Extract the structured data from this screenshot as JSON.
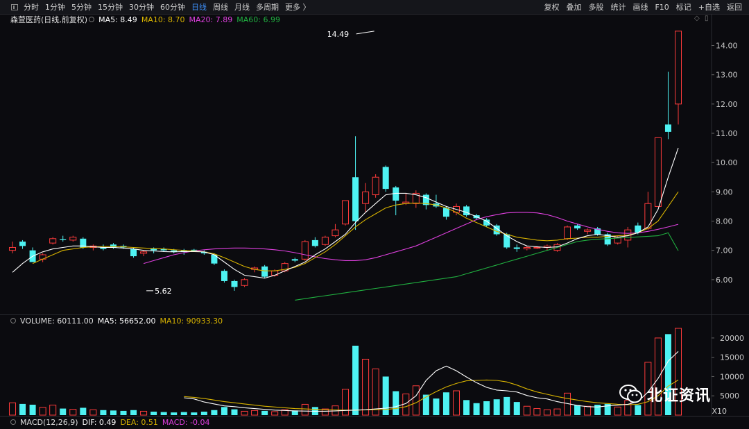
{
  "toolbar": {
    "timeframes": [
      "分时",
      "1分钟",
      "5分钟",
      "15分钟",
      "30分钟",
      "60分钟",
      "日线",
      "周线",
      "月线",
      "多周期",
      "更多 〉"
    ],
    "active_timeframe": "日线",
    "right_items": [
      "复权",
      "叠加",
      "多股",
      "统计",
      "画线",
      "F10",
      "标记",
      "+自选",
      "返回"
    ]
  },
  "main_indicator": {
    "title": "森萱医药(日线,前复权)",
    "ma5": "MA5: 8.49",
    "ma10": "MA10: 8.70",
    "ma20": "MA20: 7.89",
    "ma60": "MA60: 6.99"
  },
  "volume_indicator": {
    "vol": "VOLUME: 60111.00",
    "ma5": "MA5: 56652.00",
    "ma10": "MA10: 90933.30"
  },
  "macd_indicator": {
    "name": "MACD(12,26,9)",
    "dif": "DIF: 0.49",
    "dea": "DEA: 0.51",
    "macd": "MACD: -0.04"
  },
  "scale_label": "X10",
  "watermark": "北证资讯",
  "colors": {
    "up": "#ff3b3b",
    "down": "#4ef2f2",
    "ma5": "#ffffff",
    "ma10": "#d8b300",
    "ma20": "#e040e0",
    "ma60": "#20b040",
    "background": "#0b0b0f"
  },
  "chart_data": {
    "type": "candlestick",
    "y_ticks": [
      6.0,
      7.0,
      8.0,
      9.0,
      10.0,
      11.0,
      12.0,
      13.0,
      14.0
    ],
    "ylim": [
      5.0,
      14.7
    ],
    "volume_ticks": [
      5000,
      10000,
      15000,
      20000
    ],
    "volume_ylim": [
      0,
      22500
    ],
    "annotations": [
      {
        "text": "5.62",
        "index": 13,
        "value": 5.62
      },
      {
        "text": "14.49",
        "index": 36,
        "value": 14.49
      }
    ],
    "candles": [
      {
        "o": 7.0,
        "h": 7.3,
        "l": 6.9,
        "c": 7.1,
        "v": 3200
      },
      {
        "o": 7.3,
        "h": 7.35,
        "l": 7.05,
        "c": 7.15,
        "v": 2900
      },
      {
        "o": 7.0,
        "h": 7.1,
        "l": 6.6,
        "c": 6.6,
        "v": 2700
      },
      {
        "o": 6.7,
        "h": 6.9,
        "l": 6.6,
        "c": 6.85,
        "v": 2000
      },
      {
        "o": 7.25,
        "h": 7.45,
        "l": 7.2,
        "c": 7.4,
        "v": 2600
      },
      {
        "o": 7.38,
        "h": 7.5,
        "l": 7.3,
        "c": 7.35,
        "v": 1700
      },
      {
        "o": 7.35,
        "h": 7.5,
        "l": 7.3,
        "c": 7.45,
        "v": 1500
      },
      {
        "o": 7.4,
        "h": 7.45,
        "l": 7.05,
        "c": 7.1,
        "v": 1900
      },
      {
        "o": 7.1,
        "h": 7.2,
        "l": 7.0,
        "c": 7.15,
        "v": 1400
      },
      {
        "o": 7.1,
        "h": 7.2,
        "l": 7.0,
        "c": 7.05,
        "v": 1300
      },
      {
        "o": 7.2,
        "h": 7.25,
        "l": 7.05,
        "c": 7.1,
        "v": 1200
      },
      {
        "o": 7.15,
        "h": 7.2,
        "l": 7.05,
        "c": 7.1,
        "v": 1100
      },
      {
        "o": 7.05,
        "h": 7.1,
        "l": 6.75,
        "c": 6.8,
        "v": 1300
      },
      {
        "o": 6.9,
        "h": 7.0,
        "l": 6.8,
        "c": 6.95,
        "v": 1000
      },
      {
        "o": 7.05,
        "h": 7.1,
        "l": 6.9,
        "c": 7.0,
        "v": 900
      },
      {
        "o": 7.05,
        "h": 7.1,
        "l": 6.95,
        "c": 7.0,
        "v": 800
      },
      {
        "o": 7.0,
        "h": 7.05,
        "l": 6.9,
        "c": 6.95,
        "v": 700
      },
      {
        "o": 7.0,
        "h": 7.05,
        "l": 6.85,
        "c": 6.95,
        "v": 800
      },
      {
        "o": 7.02,
        "h": 7.05,
        "l": 6.95,
        "c": 6.98,
        "v": 700
      },
      {
        "o": 6.95,
        "h": 7.0,
        "l": 6.85,
        "c": 6.9,
        "v": 900
      },
      {
        "o": 6.85,
        "h": 6.9,
        "l": 6.5,
        "c": 6.55,
        "v": 1300
      },
      {
        "o": 6.3,
        "h": 6.35,
        "l": 5.9,
        "c": 5.95,
        "v": 2100
      },
      {
        "o": 5.95,
        "h": 6.0,
        "l": 5.62,
        "c": 5.75,
        "v": 1500
      },
      {
        "o": 5.8,
        "h": 6.05,
        "l": 5.75,
        "c": 6.0,
        "v": 1000
      },
      {
        "o": 6.35,
        "h": 6.45,
        "l": 6.25,
        "c": 6.4,
        "v": 1200
      },
      {
        "o": 6.45,
        "h": 6.5,
        "l": 6.05,
        "c": 6.1,
        "v": 1100
      },
      {
        "o": 6.15,
        "h": 6.35,
        "l": 6.1,
        "c": 6.3,
        "v": 900
      },
      {
        "o": 6.3,
        "h": 6.6,
        "l": 6.25,
        "c": 6.55,
        "v": 1400
      },
      {
        "o": 6.7,
        "h": 6.75,
        "l": 6.6,
        "c": 6.65,
        "v": 1200
      },
      {
        "o": 6.7,
        "h": 7.35,
        "l": 6.65,
        "c": 7.3,
        "v": 2800
      },
      {
        "o": 7.35,
        "h": 7.45,
        "l": 7.1,
        "c": 7.15,
        "v": 2100
      },
      {
        "o": 7.2,
        "h": 7.5,
        "l": 7.15,
        "c": 7.45,
        "v": 1600
      },
      {
        "o": 7.5,
        "h": 7.9,
        "l": 7.45,
        "c": 7.7,
        "v": 2400
      },
      {
        "o": 7.9,
        "h": 8.7,
        "l": 7.85,
        "c": 8.7,
        "v": 6700
      },
      {
        "o": 9.5,
        "h": 10.9,
        "l": 7.7,
        "c": 8.0,
        "v": 18000
      },
      {
        "o": 8.6,
        "h": 9.3,
        "l": 8.3,
        "c": 9.0,
        "v": 14500
      },
      {
        "o": 8.9,
        "h": 9.6,
        "l": 8.8,
        "c": 9.5,
        "v": 12000
      },
      {
        "o": 9.85,
        "h": 9.9,
        "l": 9.0,
        "c": 9.1,
        "v": 10000
      },
      {
        "o": 9.15,
        "h": 9.2,
        "l": 8.2,
        "c": 8.7,
        "v": 6200
      },
      {
        "o": 8.6,
        "h": 8.95,
        "l": 8.55,
        "c": 8.65,
        "v": 5500
      },
      {
        "o": 8.6,
        "h": 9.05,
        "l": 8.45,
        "c": 8.95,
        "v": 7600
      },
      {
        "o": 8.9,
        "h": 8.95,
        "l": 8.4,
        "c": 8.55,
        "v": 5300
      },
      {
        "o": 8.6,
        "h": 8.9,
        "l": 8.45,
        "c": 8.5,
        "v": 4300
      },
      {
        "o": 8.45,
        "h": 8.5,
        "l": 8.05,
        "c": 8.15,
        "v": 5900
      },
      {
        "o": 8.3,
        "h": 8.6,
        "l": 8.2,
        "c": 8.5,
        "v": 6300
      },
      {
        "o": 8.5,
        "h": 8.55,
        "l": 8.15,
        "c": 8.2,
        "v": 3900
      },
      {
        "o": 8.2,
        "h": 8.25,
        "l": 8.05,
        "c": 8.1,
        "v": 3100
      },
      {
        "o": 8.05,
        "h": 8.1,
        "l": 7.8,
        "c": 7.85,
        "v": 3600
      },
      {
        "o": 7.85,
        "h": 7.9,
        "l": 7.5,
        "c": 7.55,
        "v": 4100
      },
      {
        "o": 7.55,
        "h": 7.6,
        "l": 7.05,
        "c": 7.1,
        "v": 4700
      },
      {
        "o": 7.1,
        "h": 7.2,
        "l": 6.95,
        "c": 7.05,
        "v": 3400
      },
      {
        "o": 7.05,
        "h": 7.15,
        "l": 7.0,
        "c": 7.1,
        "v": 2300
      },
      {
        "o": 7.1,
        "h": 7.15,
        "l": 7.05,
        "c": 7.1,
        "v": 1700
      },
      {
        "o": 7.1,
        "h": 7.2,
        "l": 7.0,
        "c": 7.15,
        "v": 1400
      },
      {
        "o": 7.0,
        "h": 7.25,
        "l": 6.95,
        "c": 7.2,
        "v": 1600
      },
      {
        "o": 7.4,
        "h": 7.85,
        "l": 7.35,
        "c": 7.8,
        "v": 5700
      },
      {
        "o": 7.85,
        "h": 7.9,
        "l": 7.7,
        "c": 7.75,
        "v": 2600
      },
      {
        "o": 7.65,
        "h": 7.75,
        "l": 7.55,
        "c": 7.7,
        "v": 2300
      },
      {
        "o": 7.75,
        "h": 7.8,
        "l": 7.5,
        "c": 7.55,
        "v": 2700
      },
      {
        "o": 7.55,
        "h": 7.6,
        "l": 7.15,
        "c": 7.2,
        "v": 2900
      },
      {
        "o": 7.25,
        "h": 7.5,
        "l": 7.2,
        "c": 7.45,
        "v": 2100
      },
      {
        "o": 7.35,
        "h": 7.8,
        "l": 7.1,
        "c": 7.7,
        "v": 3800
      },
      {
        "o": 7.85,
        "h": 7.95,
        "l": 7.55,
        "c": 7.6,
        "v": 2600
      },
      {
        "o": 7.75,
        "h": 9.0,
        "l": 7.7,
        "c": 8.6,
        "v": 13700
      },
      {
        "o": 8.5,
        "h": 10.85,
        "l": 8.5,
        "c": 10.85,
        "v": 20000
      },
      {
        "o": 11.3,
        "h": 13.1,
        "l": 10.8,
        "c": 11.05,
        "v": 21000
      },
      {
        "o": 12.0,
        "h": 14.49,
        "l": 11.3,
        "c": 14.49,
        "v": 22500
      }
    ],
    "ma5": [
      6.25,
      6.55,
      6.8,
      6.95,
      7.05,
      7.1,
      7.15,
      7.15,
      7.12,
      7.1,
      7.1,
      7.08,
      7.05,
      7.0,
      6.98,
      6.96,
      6.95,
      6.96,
      6.96,
      6.95,
      6.85,
      6.6,
      6.35,
      6.15,
      6.1,
      6.05,
      6.15,
      6.3,
      6.45,
      6.6,
      6.85,
      7.05,
      7.3,
      7.55,
      7.95,
      8.3,
      8.6,
      8.9,
      8.95,
      8.95,
      8.9,
      8.8,
      8.65,
      8.5,
      8.4,
      8.3,
      8.15,
      8.0,
      7.75,
      7.5,
      7.3,
      7.15,
      7.12,
      7.1,
      7.12,
      7.25,
      7.4,
      7.5,
      7.55,
      7.5,
      7.45,
      7.5,
      7.6,
      7.8,
      8.4,
      9.5,
      10.5
    ],
    "ma10": [
      6.55,
      6.7,
      6.85,
      7.0,
      7.05,
      7.1,
      7.12,
      7.13,
      7.13,
      7.12,
      7.1,
      7.08,
      7.06,
      7.05,
      7.02,
      7.0,
      6.98,
      6.95,
      6.88,
      6.75,
      6.6,
      6.45,
      6.35,
      6.3,
      6.3,
      6.35,
      6.42,
      6.55,
      6.75,
      6.95,
      7.2,
      7.5,
      7.8,
      8.05,
      8.25,
      8.45,
      8.55,
      8.6,
      8.62,
      8.6,
      8.55,
      8.45,
      8.3,
      8.1,
      7.95,
      7.8,
      7.65,
      7.55,
      7.45,
      7.4,
      7.35,
      7.33,
      7.35,
      7.4,
      7.42,
      7.45,
      7.45,
      7.48,
      7.5,
      7.52,
      7.6,
      7.75,
      8.0,
      8.5,
      9.0
    ],
    "ma20": [
      6.55,
      6.65,
      6.75,
      6.85,
      6.92,
      6.98,
      7.02,
      7.05,
      7.07,
      7.08,
      7.08,
      7.07,
      7.05,
      7.02,
      6.98,
      6.92,
      6.85,
      6.78,
      6.72,
      6.68,
      6.65,
      6.65,
      6.68,
      6.75,
      6.85,
      6.95,
      7.05,
      7.15,
      7.3,
      7.45,
      7.6,
      7.75,
      7.9,
      8.05,
      8.15,
      8.22,
      8.28,
      8.3,
      8.3,
      8.28,
      8.22,
      8.12,
      8.0,
      7.9,
      7.8,
      7.72,
      7.65,
      7.6,
      7.58,
      7.6,
      7.65,
      7.72,
      7.8,
      7.89
    ],
    "ma60": [
      5.3,
      5.35,
      5.4,
      5.45,
      5.5,
      5.55,
      5.6,
      5.65,
      5.7,
      5.75,
      5.8,
      5.85,
      5.9,
      5.95,
      6.0,
      6.05,
      6.1,
      6.2,
      6.3,
      6.4,
      6.5,
      6.6,
      6.7,
      6.8,
      6.9,
      7.0,
      7.1,
      7.2,
      7.3,
      7.35,
      7.38,
      7.4,
      7.42,
      7.44,
      7.46,
      7.48,
      7.5,
      7.6,
      6.99
    ],
    "vol_ma5": [
      4500,
      4200,
      3400,
      2900,
      2400,
      2200,
      1900,
      1700,
      1500,
      1300,
      1200,
      1100,
      1050,
      1000,
      1000,
      1100,
      1200,
      1300,
      1400,
      1600,
      1800,
      2200,
      3000,
      5000,
      9000,
      11500,
      12700,
      11500,
      9900,
      8400,
      7200,
      6500,
      6300,
      6000,
      5100,
      4500,
      4200,
      3500,
      3000,
      2500,
      2200,
      2100,
      2400,
      2600,
      2800,
      3500,
      6000,
      9500,
      14000,
      16500
    ],
    "vol_ma10": [
      4800,
      4600,
      4300,
      3900,
      3500,
      3200,
      2900,
      2600,
      2300,
      2100,
      1900,
      1700,
      1600,
      1500,
      1400,
      1350,
      1300,
      1300,
      1350,
      1400,
      1500,
      1700,
      2200,
      3200,
      4700,
      6100,
      7300,
      8200,
      8900,
      9000,
      9100,
      9000,
      8600,
      7800,
      6800,
      6000,
      5400,
      4800,
      4300,
      3900,
      3500,
      3200,
      3000,
      2800,
      2700,
      2800,
      3500,
      5000,
      7500,
      9100
    ]
  }
}
